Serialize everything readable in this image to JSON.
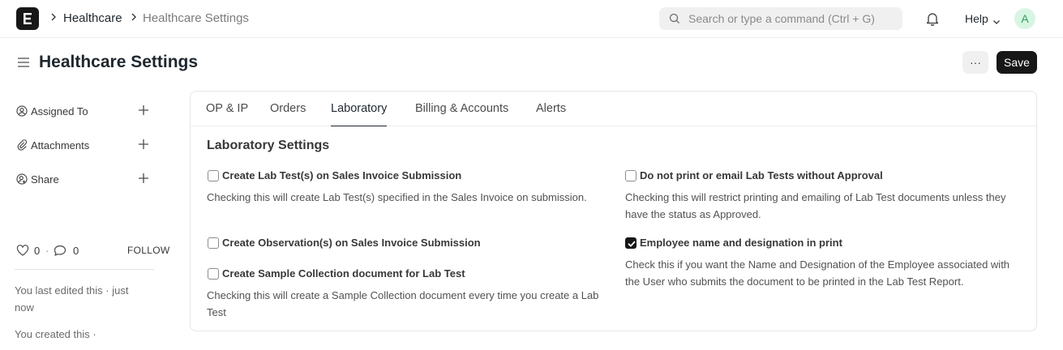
{
  "navbar": {
    "logo_letter": "E",
    "breadcrumbs": [
      "Healthcare",
      "Healthcare Settings"
    ],
    "search_placeholder": "Search or type a command (Ctrl + G)",
    "help_label": "Help",
    "avatar_letter": "A"
  },
  "page": {
    "title": "Healthcare Settings",
    "more_label": "···",
    "save_label": "Save"
  },
  "sidebar": {
    "items": [
      {
        "label": "Assigned To",
        "icon": "user-check-icon"
      },
      {
        "label": "Attachments",
        "icon": "paperclip-icon"
      },
      {
        "label": "Share",
        "icon": "share-icon"
      }
    ],
    "likes_count": "0",
    "comments_count": "0",
    "follow_label": "FOLLOW",
    "last_edited": "You last edited this · just now",
    "created": "You created this ·"
  },
  "tabs": [
    {
      "label": "OP & IP",
      "active": false
    },
    {
      "label": "Orders",
      "active": false
    },
    {
      "label": "Laboratory",
      "active": true
    },
    {
      "label": "Billing & Accounts",
      "active": false
    },
    {
      "label": "Alerts",
      "active": false
    }
  ],
  "section": {
    "title": "Laboratory Settings",
    "fields": [
      {
        "label": "Create Lab Test(s) on Sales Invoice Submission",
        "checked": false,
        "description": "Checking this will create Lab Test(s) specified in the Sales Invoice on submission."
      },
      {
        "label": "Do not print or email Lab Tests without Approval",
        "checked": false,
        "description": "Checking this will restrict printing and emailing of Lab Test documents unless they have the status as Approved."
      },
      {
        "label": "Create Observation(s) on Sales Invoice Submission",
        "checked": false,
        "description": ""
      },
      {
        "label": "Employee name and designation in print",
        "checked": true,
        "description": "Check this if you want the Name and Designation of the Employee associated with the User who submits the document to be printed in the Lab Test Report."
      },
      {
        "label": "Create Sample Collection document for Lab Test",
        "checked": false,
        "description": "Checking this will create a Sample Collection document every time you create a Lab Test"
      }
    ]
  },
  "colors": {
    "primary_button": "#171717",
    "avatar_bg": "#d8f5e3",
    "avatar_text": "#2f9d5a"
  }
}
